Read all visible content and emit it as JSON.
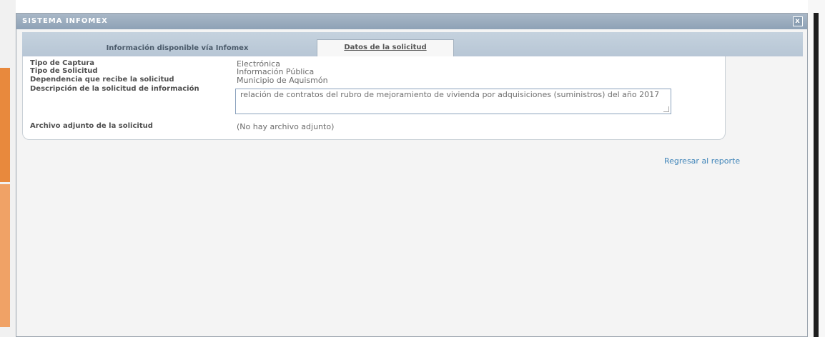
{
  "window": {
    "title": "SISTEMA INFOMEX",
    "close_label": "x"
  },
  "tabs": [
    {
      "label": "Información disponible vía Infomex"
    },
    {
      "label": "Datos de la solicitud"
    }
  ],
  "fields": [
    {
      "label": "Tipo de Captura",
      "value": "Electrónica"
    },
    {
      "label": "Tipo de Solicitud",
      "value": "Información Pública"
    },
    {
      "label": "Dependencia que recibe la solicitud",
      "value": "Municipio de Aquismón"
    },
    {
      "label": "Descripción de la solicitud de información",
      "value": "relación de contratos del rubro de mejoramiento de vivienda por adquisiciones (suministros) del año 2017"
    },
    {
      "label": "Archivo adjunto de la solicitud",
      "value": "(No hay archivo adjunto)"
    }
  ],
  "back_link": "Regresar al reporte"
}
